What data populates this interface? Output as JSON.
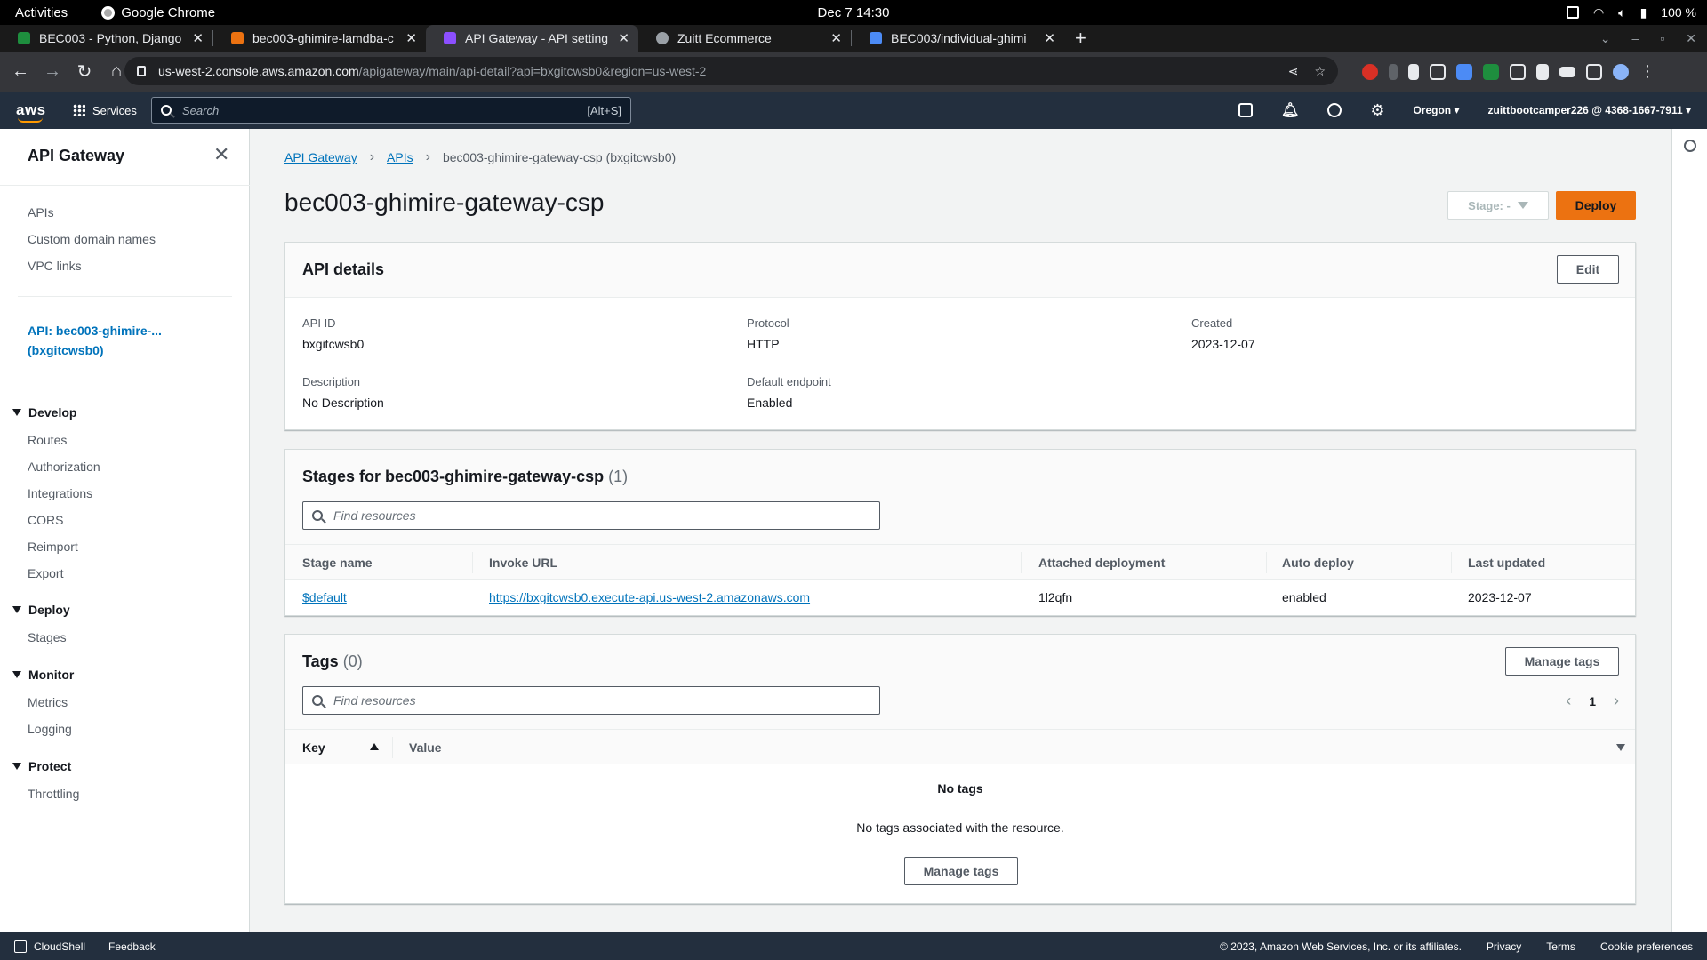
{
  "os": {
    "activities": "Activities",
    "app_name": "Google Chrome",
    "clock": "Dec 7  14:30",
    "battery": "100 %"
  },
  "browser": {
    "tabs": [
      {
        "title": "BEC003 - Python, Django",
        "favicon_color": "#1e8e3e"
      },
      {
        "title": "bec003-ghimire-lamdba-c",
        "favicon_color": "#ec7211"
      },
      {
        "title": "API Gateway - API setting",
        "favicon_color": "#8c4fff"
      },
      {
        "title": "Zuitt Ecommerce",
        "favicon_color": "#9aa0a6"
      },
      {
        "title": "BEC003/individual-ghimi",
        "favicon_color": "#4c8bf5"
      }
    ],
    "active_tab": 2,
    "url_host": "us-west-2.console.aws.amazon.com",
    "url_path": "/apigateway/main/api-detail?api=bxgitcwsb0&region=us-west-2"
  },
  "aws": {
    "logo": "aws",
    "services": "Services",
    "search_placeholder": "Search",
    "search_hint": "[Alt+S]",
    "region": "Oregon",
    "account": "zuittbootcamper226 @ 4368-1667-7911"
  },
  "sidebar": {
    "title": "API Gateway",
    "top_links": [
      "APIs",
      "Custom domain names",
      "VPC links"
    ],
    "active_api_line1": "API: bec003-ghimire-...",
    "active_api_line2": "(bxgitcwsb0)",
    "sections": [
      {
        "name": "Develop",
        "items": [
          "Routes",
          "Authorization",
          "Integrations",
          "CORS",
          "Reimport",
          "Export"
        ]
      },
      {
        "name": "Deploy",
        "items": [
          "Stages"
        ]
      },
      {
        "name": "Monitor",
        "items": [
          "Metrics",
          "Logging"
        ]
      },
      {
        "name": "Protect",
        "items": [
          "Throttling"
        ]
      }
    ]
  },
  "breadcrumb": {
    "items": [
      "API Gateway",
      "APIs"
    ],
    "current": "bec003-ghimire-gateway-csp (bxgitcwsb0)"
  },
  "page": {
    "title": "bec003-ghimire-gateway-csp",
    "stage_select": "Stage: -",
    "deploy_label": "Deploy"
  },
  "api_details": {
    "title": "API details",
    "edit_label": "Edit",
    "fields": {
      "api_id_label": "API ID",
      "api_id": "bxgitcwsb0",
      "protocol_label": "Protocol",
      "protocol": "HTTP",
      "created_label": "Created",
      "created": "2023-12-07",
      "description_label": "Description",
      "description": "No Description",
      "default_endpoint_label": "Default endpoint",
      "default_endpoint": "Enabled"
    }
  },
  "stages": {
    "title": "Stages for bec003-ghimire-gateway-csp",
    "count": "(1)",
    "filter_placeholder": "Find resources",
    "columns": [
      "Stage name",
      "Invoke URL",
      "Attached deployment",
      "Auto deploy",
      "Last updated"
    ],
    "rows": [
      {
        "stage": "$default",
        "url": "https://bxgitcwsb0.execute-api.us-west-2.amazonaws.com",
        "deployment": "1l2qfn",
        "auto_deploy": "enabled",
        "updated": "2023-12-07"
      }
    ]
  },
  "tags": {
    "title": "Tags",
    "count": "(0)",
    "manage_label": "Manage tags",
    "filter_placeholder": "Find resources",
    "page": "1",
    "columns": [
      "Key",
      "Value"
    ],
    "empty_title": "No tags",
    "empty_sub": "No tags associated with the resource.",
    "empty_button": "Manage tags"
  },
  "footer": {
    "cloudshell": "CloudShell",
    "feedback": "Feedback",
    "copyright": "© 2023, Amazon Web Services, Inc. or its affiliates.",
    "links": [
      "Privacy",
      "Terms",
      "Cookie preferences"
    ]
  }
}
